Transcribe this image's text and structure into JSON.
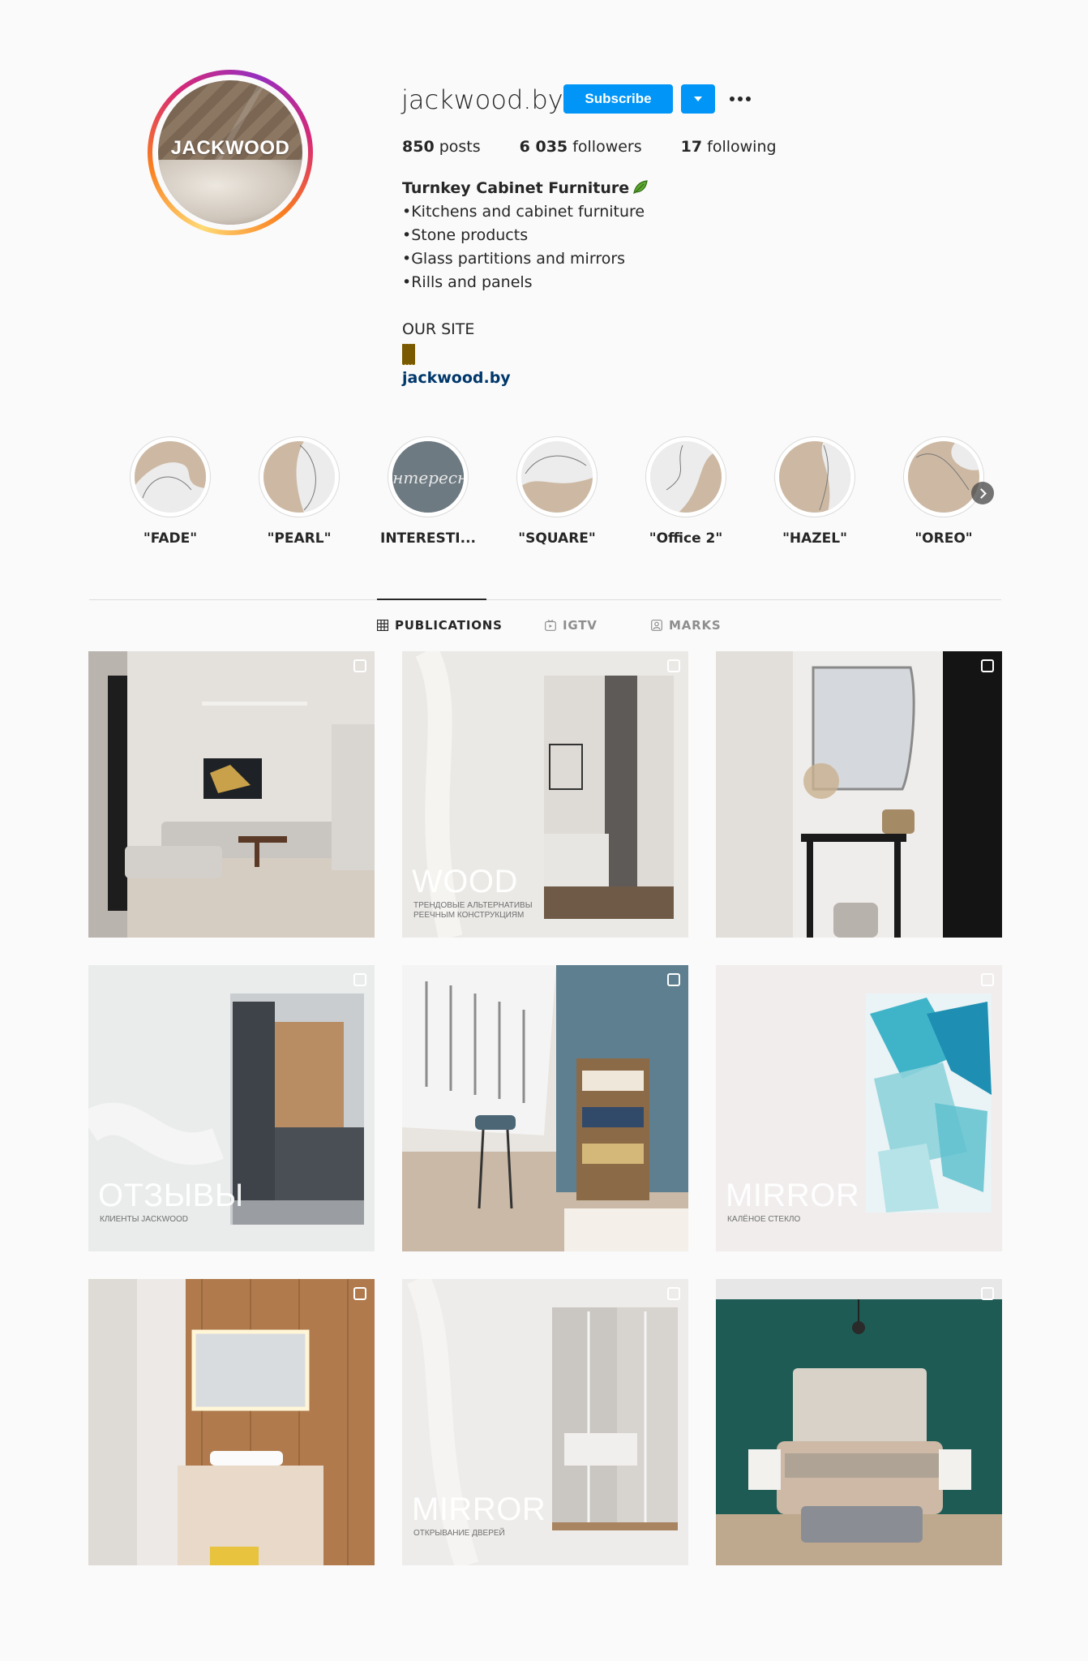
{
  "profile": {
    "username": "jackwood.by",
    "avatar_text": "JACKWOOD",
    "subscribe_label": "Subscribe",
    "stats": {
      "posts": "850",
      "posts_label": "posts",
      "followers": "6 035",
      "followers_label": "followers",
      "following": "17",
      "following_label": "following"
    },
    "bio": {
      "title": "Turnkey Cabinet Furniture",
      "lines": [
        "•Kitchens and cabinet furniture",
        "•Stone products",
        "•Glass partitions and mirrors",
        "•Rills and panels"
      ],
      "site_label": "OUR SITE",
      "link": "jackwood.by"
    }
  },
  "highlights": [
    {
      "label": "\"FADE\""
    },
    {
      "label": "\"PEARL\""
    },
    {
      "label": "INTERESTI..."
    },
    {
      "label": "\"SQUARE\""
    },
    {
      "label": "\"Office 2\""
    },
    {
      "label": "\"HAZEL\""
    },
    {
      "label": "\"OREO\""
    }
  ],
  "tabs": [
    {
      "label": "PUBLICATIONS",
      "icon": "grid-icon",
      "active": true
    },
    {
      "label": "IGTV",
      "icon": "igtv-icon",
      "active": false
    },
    {
      "label": "MARKS",
      "icon": "tagged-icon",
      "active": false
    }
  ],
  "posts": [
    {
      "title": "",
      "subtitle": ""
    },
    {
      "title": "WOOD",
      "subtitle": "ТРЕНДОВЫЕ АЛЬТЕРНАТИВЫ РЕЕЧНЫМ КОНСТРУКЦИЯМ"
    },
    {
      "title": "",
      "subtitle": ""
    },
    {
      "title": "ОТЗЫВЫ",
      "subtitle": "КЛИЕНТЫ JACKWOOD"
    },
    {
      "title": "",
      "subtitle": ""
    },
    {
      "title": "MIRROR",
      "subtitle": "КАЛЁНОЕ СТЕКЛО"
    },
    {
      "title": "",
      "subtitle": ""
    },
    {
      "title": "MIRROR",
      "subtitle": "ОТКРЫВАНИЕ ДВЕРЕЙ"
    },
    {
      "title": "",
      "subtitle": ""
    }
  ],
  "colors": {
    "accent": "#0095f6",
    "link": "#00376b",
    "text": "#262626",
    "muted": "#8e8e8e",
    "background": "#fafafa",
    "highlight_beige": "#cdb9a3"
  }
}
